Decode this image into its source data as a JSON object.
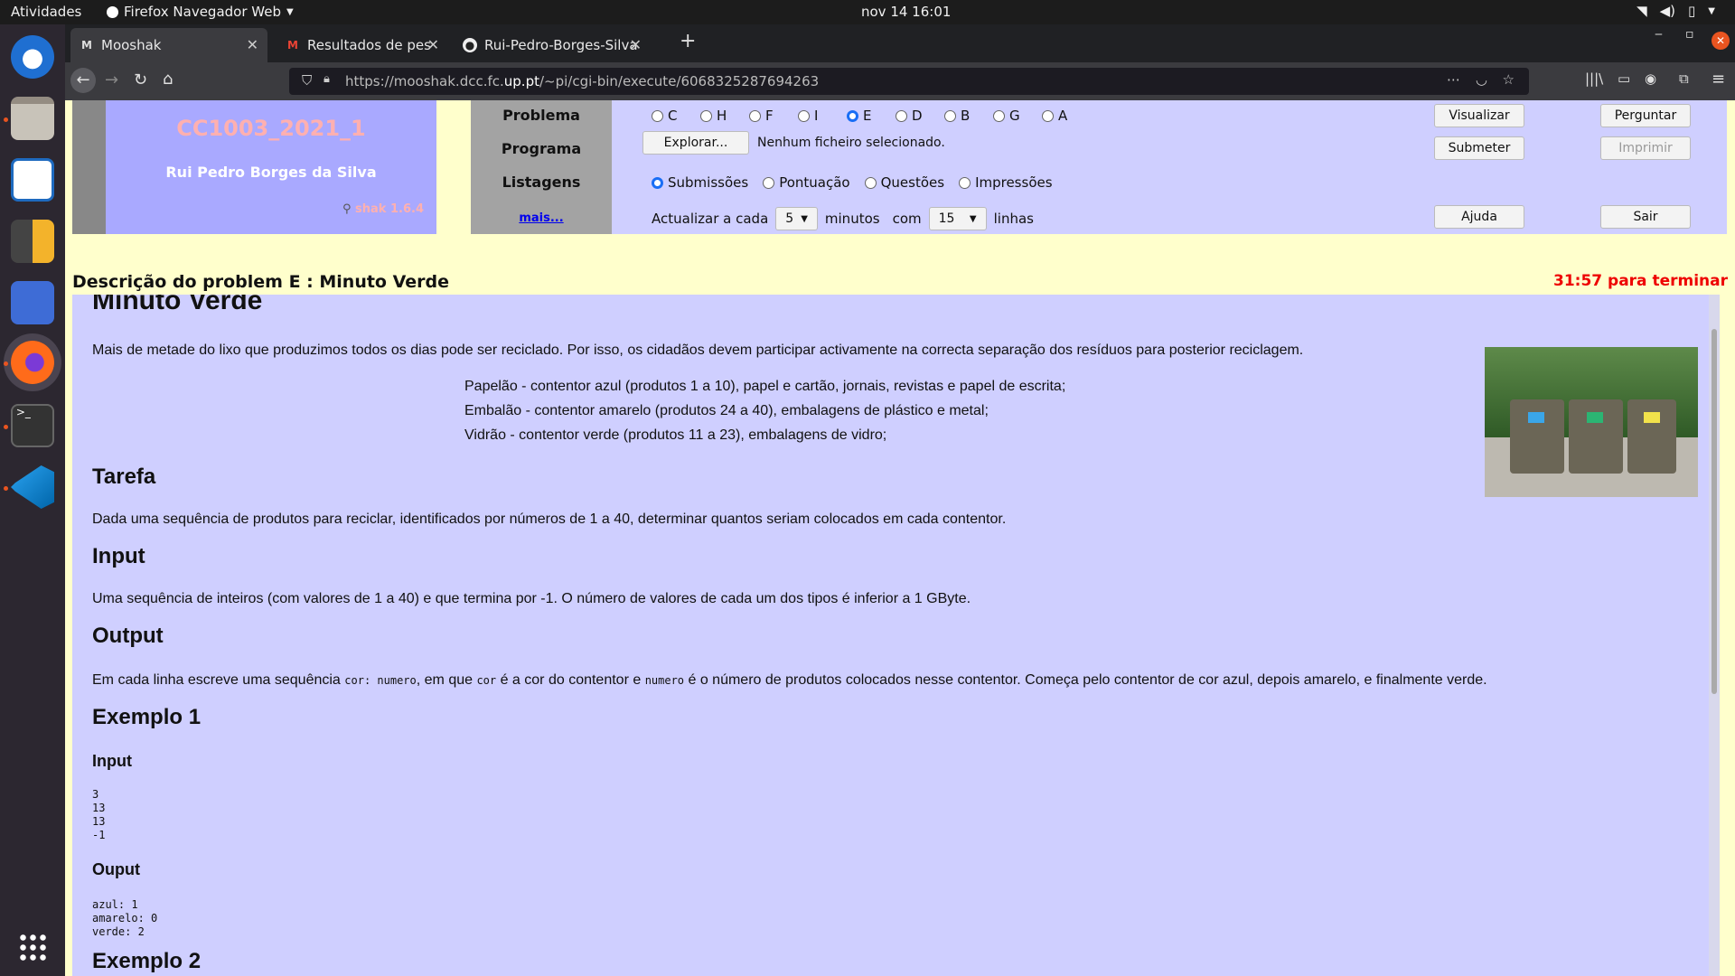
{
  "ubuntu": {
    "activities": "Atividades",
    "app_name": "Firefox Navegador Web",
    "clock": "nov 14  16:01"
  },
  "browser": {
    "tabs": [
      {
        "title": "Mooshak",
        "favicon": "M"
      },
      {
        "title": "Resultados de pesquisa",
        "favicon": "gmail"
      },
      {
        "title": "Rui-Pedro-Borges-Silva",
        "favicon": "github"
      }
    ],
    "url_prefix": "https://mooshak.dcc.fc.",
    "url_domain": "up.pt",
    "url_suffix": "/~pi/cgi-bin/execute/6068325287694263"
  },
  "mooshak": {
    "contest": "CC1003_2021_1",
    "user": "Rui Pedro Borges da Silva",
    "version": "shak 1.6.4",
    "labels": {
      "problema": "Problema",
      "programa": "Programa",
      "listagens": "Listagens",
      "mais": "mais..."
    },
    "problems": [
      "C",
      "H",
      "F",
      "I",
      "E",
      "D",
      "B",
      "G",
      "A"
    ],
    "selected_problem": "E",
    "explore_button": "Explorar...",
    "file_status": "Nenhum ficheiro selecionado.",
    "listings": [
      "Submissões",
      "Pontuação",
      "Questões",
      "Impressões"
    ],
    "selected_listing": "Submissões",
    "update": {
      "prefix": "Actualizar a cada",
      "minutes": "5",
      "mid": "minutos",
      "com": "com",
      "lines": "15",
      "suffix": "linhas"
    },
    "buttons": {
      "visualizar": "Visualizar",
      "perguntar": "Perguntar",
      "submeter": "Submeter",
      "imprimir": "Imprimir",
      "ajuda": "Ajuda",
      "sair": "Sair"
    },
    "heading": "Descrição do problem E : Minuto Verde",
    "timer": "31:57 para terminar"
  },
  "problem": {
    "title": "Minuto Verde",
    "intro": "Mais de metade do lixo que produzimos todos os dias pode ser reciclado. Por isso, os cidadãos devem participar activamente na correcta separação dos resíduos para posterior reciclagem.",
    "bins": [
      "Papelão - contentor azul (produtos 1 a 10), papel e cartão, jornais, revistas e papel de escrita;",
      "Embalão - contentor amarelo (produtos 24 a 40), embalagens de plástico e metal;",
      "Vidrão - contentor verde (produtos 11 a 23), embalagens de vidro;"
    ],
    "tarefa_title": "Tarefa",
    "tarefa": "Dada uma sequência de produtos para reciclar, identificados por números de 1 a 40, determinar quantos seriam colocados em cada contentor.",
    "input_title": "Input",
    "input": "Uma sequência de inteiros (com valores de 1 a 40) e que termina por -1. O número de valores de cada um dos tipos é inferior a 1 GByte.",
    "output_title": "Output",
    "output_a": "Em cada linha escreve uma sequência ",
    "output_code1": "cor: numero",
    "output_b": ", em que ",
    "output_code2": "cor",
    "output_c": " é a cor do contentor e ",
    "output_code3": "numero",
    "output_d": " é o número de produtos colocados nesse contentor. Começa pelo contentor de cor azul, depois amarelo, e finalmente verde.",
    "ex1_title": "Exemplo 1",
    "ex1_input_title": "Input",
    "ex1_input": "3\n13\n13\n-1",
    "ex1_output_title": "Ouput",
    "ex1_output": "azul: 1\namarelo: 0\nverde: 2",
    "ex2_title": "Exemplo 2"
  }
}
